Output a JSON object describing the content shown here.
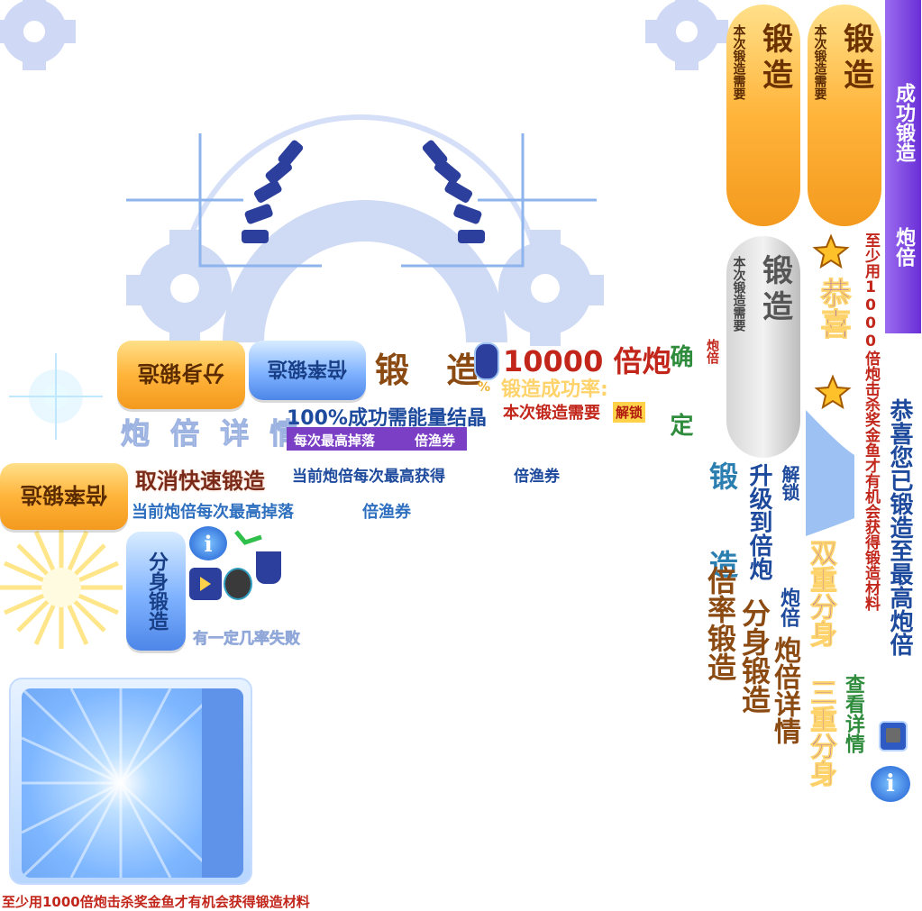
{
  "pills": {
    "forge_1": {
      "title": "锻造",
      "sub": "本次锻造需要"
    },
    "forge_2": {
      "title": "锻造",
      "sub": "本次锻造需要"
    },
    "forge_gray": {
      "title": "锻造",
      "sub": "本次锻造需要"
    }
  },
  "ribbon": {
    "title": "成功锻造",
    "sub": "炮倍"
  },
  "vertical": {
    "min_1000": "至少用1000倍炮击杀奖金鱼才有机会获得锻造材料",
    "congrats_big": "恭喜",
    "congrats_max": "恭喜您已锻造至最高炮倍",
    "unlock": "解锁",
    "upgrade_to": "升级到倍炮",
    "forge_spaced": "锻 造",
    "rate_forge": "倍率锻造",
    "double_triple": "双重分身 三重分身",
    "cannon_multiplier": "炮倍",
    "cannon_detail": "炮倍详情",
    "clone_forge": "分身锻造",
    "view_detail": "查看详情"
  },
  "buttons": {
    "clone_forge": "分身锻造",
    "rate_forge": "倍率锻造",
    "rate_forge_2": "倍率锻造",
    "clone_forge_v": "分身锻造"
  },
  "middle": {
    "forge_spaced": "锻 造",
    "amount": "10000 倍炮",
    "multiplier_small": "炮倍",
    "success_rate": "锻造成功率:",
    "percent": "%",
    "confirm": "确 定",
    "cannon_detail": "炮 倍 详 情",
    "need_crystal": "100%成功需能量结晶",
    "need_forge": "本次锻造需要",
    "unlock_tag": "解锁",
    "max_drop": "每次最高掉落",
    "voucher": "倍渔券",
    "cancel_fast": "取消快速锻造",
    "current_max_get": "当前炮倍每次最高获得",
    "voucher_2": "倍渔券",
    "current_max_drop": "当前炮倍每次最高掉落",
    "voucher_3": "倍渔券",
    "fail_chance": "有一定几率失败"
  },
  "bottom_note": "至少用1000倍炮击杀奖金鱼才有机会获得锻造材料",
  "colors": {
    "accent_blue": "#1d4a9c",
    "accent_red": "#c2261b",
    "gear": "#cfdcf7",
    "orange": "#ffb43a"
  }
}
